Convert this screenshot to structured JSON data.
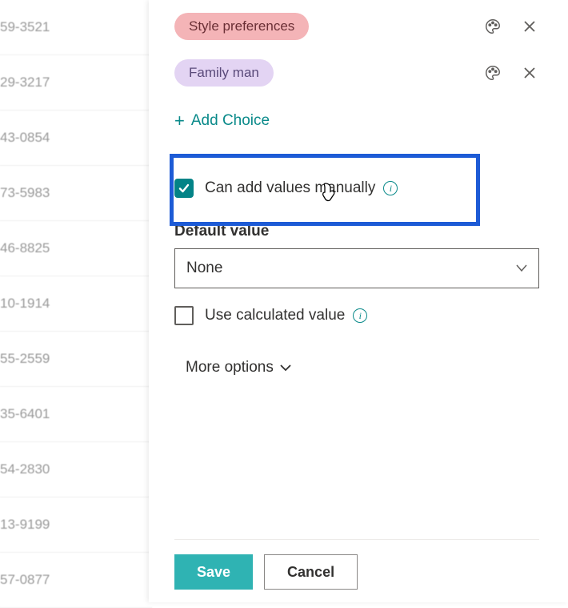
{
  "background_rows": [
    "59-3521",
    "29-3217",
    "43-0854",
    "73-5983",
    "46-8825",
    "10-1914",
    "55-2559",
    "35-6401",
    "54-2830",
    "13-9199",
    "57-0877"
  ],
  "choices": [
    {
      "label": "Style preferences",
      "pill_class": "pill-pink"
    },
    {
      "label": "Family man",
      "pill_class": "pill-lilac"
    }
  ],
  "add_choice_label": "Add Choice",
  "manual_values": {
    "label": "Can add values manually",
    "checked": true
  },
  "default_value": {
    "section_label": "Default value",
    "selected": "None"
  },
  "calculated": {
    "label": "Use calculated value",
    "checked": false
  },
  "more_options_label": "More options",
  "buttons": {
    "save": "Save",
    "cancel": "Cancel"
  }
}
